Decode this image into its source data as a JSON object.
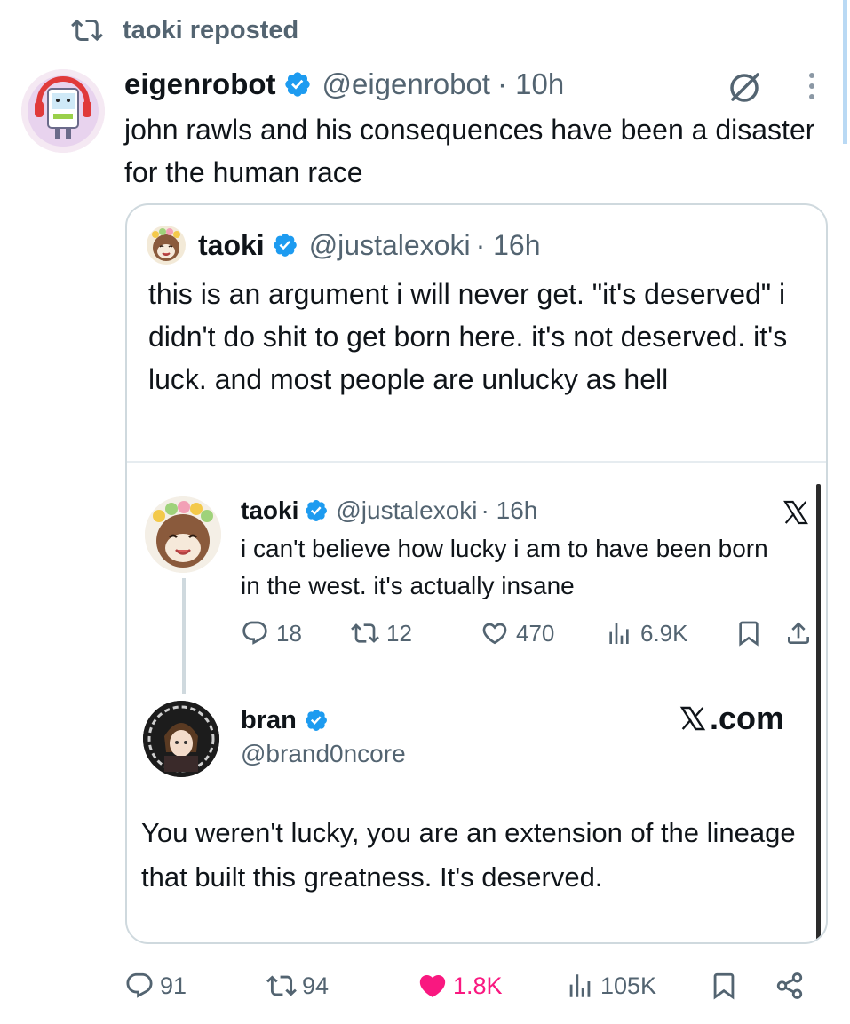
{
  "repost": {
    "label": "taoki reposted"
  },
  "post": {
    "author_name": "eigenrobot",
    "handle": "@eigenrobot",
    "time": "· 10h",
    "text": "john rawls and his consequences have been a disaster for the human race",
    "stats": {
      "replies": "91",
      "reposts": "94",
      "likes": "1.8K",
      "views": "105K"
    }
  },
  "quote": {
    "author_name": "taoki",
    "handle": "@justalexoki",
    "time": "· 16h",
    "text": "this is an argument i will never get. \"it's deserved\" i didn't do shit to get born here. it's not deserved. it's luck. and most people are unlucky as hell"
  },
  "embed": {
    "first": {
      "author_name": "taoki",
      "handle": "@justalexoki",
      "time": "· 16h",
      "text": "i can't believe how lucky i am to have been born in the west. it's actually insane",
      "stats": {
        "replies": "18",
        "reposts": "12",
        "likes": "470",
        "views": "6.9K"
      }
    },
    "second": {
      "author_name": "bran",
      "handle": "@brand0ncore",
      "text": "You weren't lucky, you are an extension of the lineage that built this greatness. It's deserved."
    },
    "site_label": ".com"
  },
  "colors": {
    "verified": "#1d9bf0",
    "like": "#f91880",
    "muted": "#536471",
    "border": "#cfd9de"
  },
  "icons": [
    "retweet-icon",
    "verified-badge-icon",
    "grok-icon",
    "more-icon",
    "x-logo-icon",
    "reply-icon",
    "like-icon",
    "views-icon",
    "bookmark-icon",
    "share-icon"
  ]
}
